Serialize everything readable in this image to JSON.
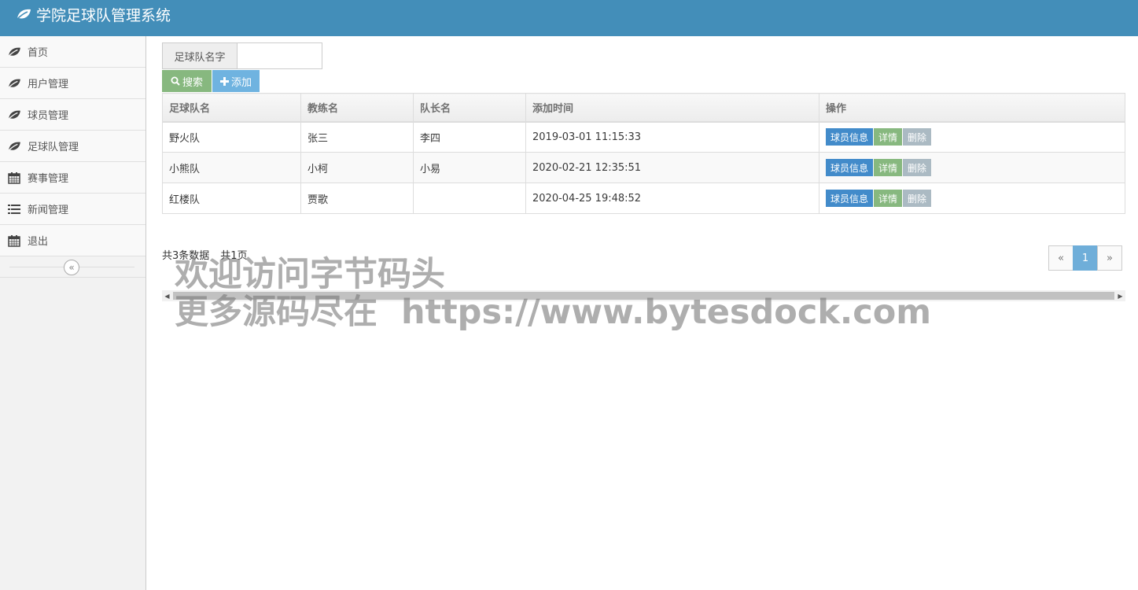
{
  "app": {
    "title": "学院足球队管理系统",
    "brand_icon": "leaf-icon"
  },
  "sidebar": {
    "items": [
      {
        "label": "首页",
        "icon": "leaf-icon"
      },
      {
        "label": "用户管理",
        "icon": "leaf-icon"
      },
      {
        "label": "球员管理",
        "icon": "leaf-icon"
      },
      {
        "label": "足球队管理",
        "icon": "leaf-icon"
      },
      {
        "label": "赛事管理",
        "icon": "calendar-icon"
      },
      {
        "label": "新闻管理",
        "icon": "list-icon"
      },
      {
        "label": "退出",
        "icon": "calendar-icon"
      }
    ],
    "collapse_symbol": "«"
  },
  "search": {
    "label": "足球队名字",
    "value": "",
    "search_button": "搜索",
    "add_button": "添加"
  },
  "table": {
    "headers": [
      "足球队名",
      "教练名",
      "队长名",
      "添加时间",
      "操作"
    ],
    "rows": [
      {
        "team": "野火队",
        "coach": "张三",
        "captain": "李四",
        "added": "2019-03-01 11:15:33"
      },
      {
        "team": "小熊队",
        "coach": "小柯",
        "captain": "小易",
        "added": "2020-02-21 12:35:51"
      },
      {
        "team": "红楼队",
        "coach": "贾歌",
        "captain": "",
        "added": "2020-04-25 19:48:52"
      }
    ],
    "actions": {
      "info": "球员信息",
      "detail": "详情",
      "delete": "删除"
    }
  },
  "pagination": {
    "total_text": "共3条数据",
    "pages_text": "共1页",
    "prev": "«",
    "current": "1",
    "next": "»"
  },
  "watermark": {
    "line1": "欢迎访问字节码头",
    "line2": "更多源码尽在  https://www.bytesdock.com"
  },
  "colors": {
    "topbar": "#438eb9",
    "search_btn": "#87b87f",
    "add_btn": "#6fb3e0",
    "info_btn": "#428bca",
    "delete_btn": "#abbac3",
    "page_active": "#6faed9"
  }
}
